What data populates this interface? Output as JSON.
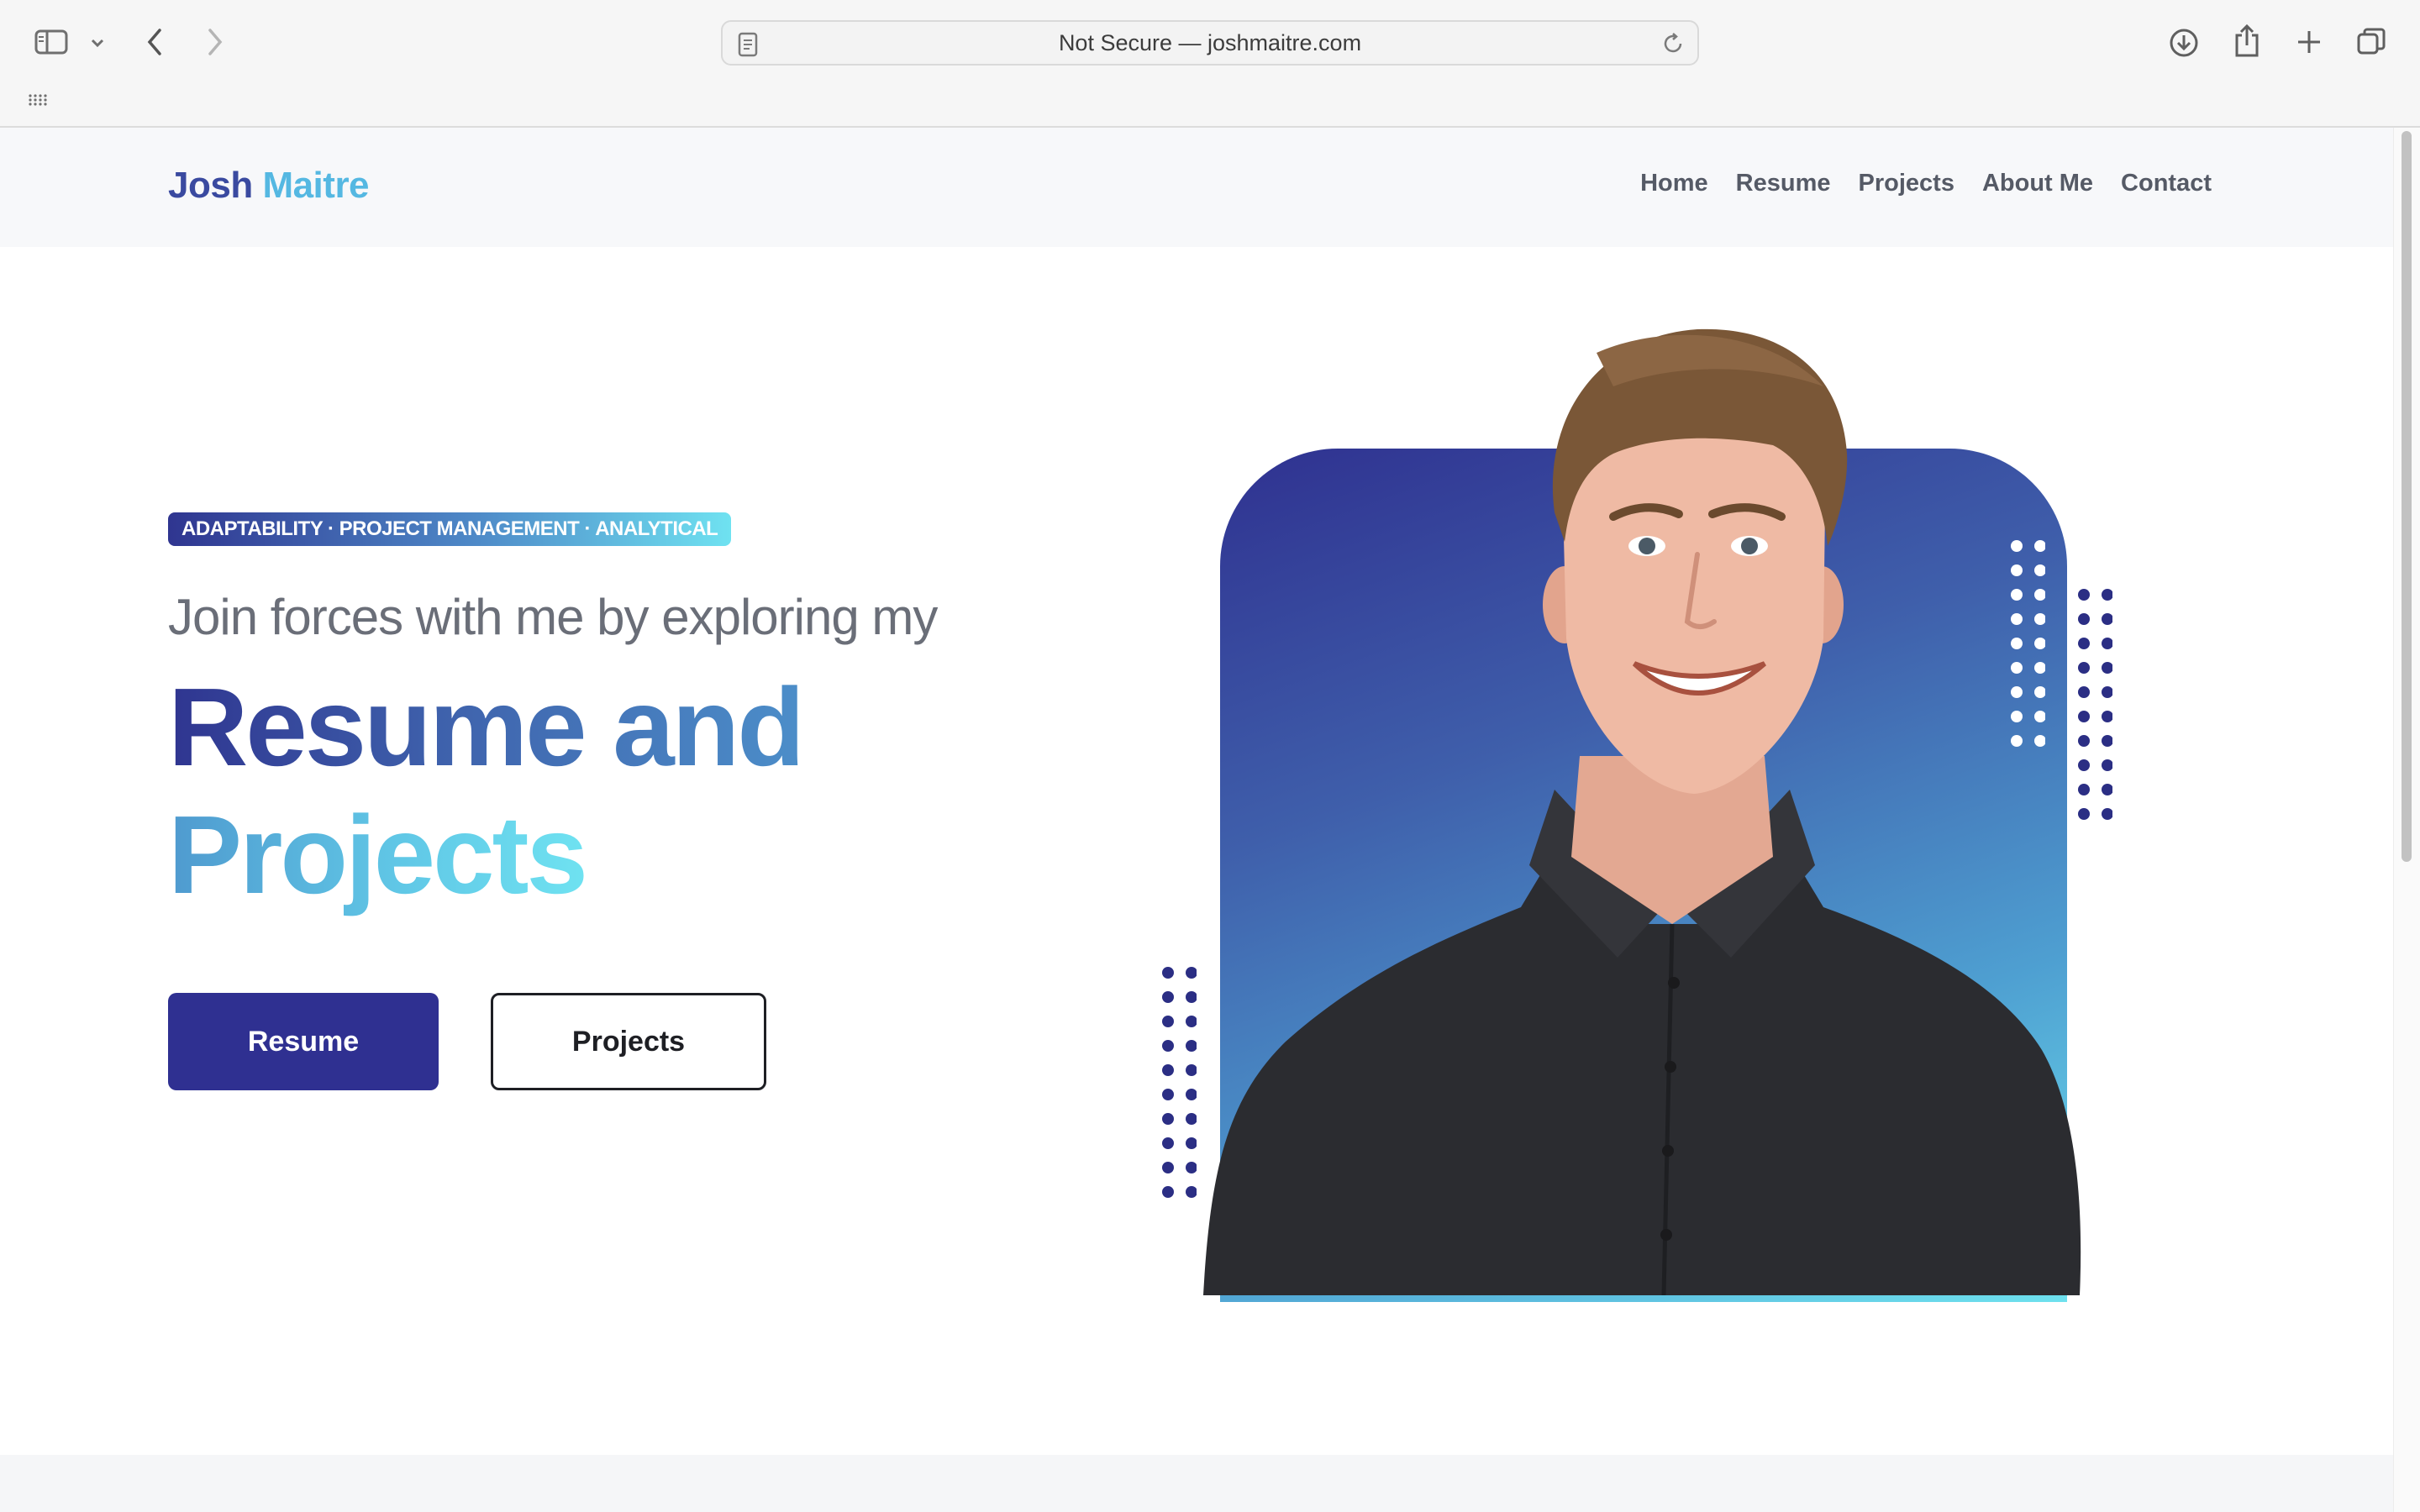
{
  "browser": {
    "url": "Not Secure — joshmaitre.com",
    "icons": [
      "sidebar-icon",
      "chevron-down-icon",
      "back-icon",
      "forward-icon",
      "page-icon",
      "reload-icon",
      "download-icon",
      "share-icon",
      "new-tab-icon",
      "tabs-overview-icon",
      "grid-icon"
    ]
  },
  "header": {
    "logo_first": "Josh",
    "logo_last": "Maitre",
    "nav": [
      "Home",
      "Resume",
      "Projects",
      "About Me",
      "Contact"
    ]
  },
  "hero": {
    "tagline": "ADAPTABILITY · PROJECT MANAGEMENT · ANALYTICAL",
    "intro": "Join forces with me by exploring my",
    "headline_1": "Resume and",
    "headline_2": "Projects",
    "primary_button": "Resume",
    "secondary_button": "Projects"
  },
  "colors": {
    "brand_dark": "#2f3091",
    "brand_mid": "#4e8ac8",
    "brand_light": "#6fe2f1",
    "nav_text": "#555a66"
  }
}
